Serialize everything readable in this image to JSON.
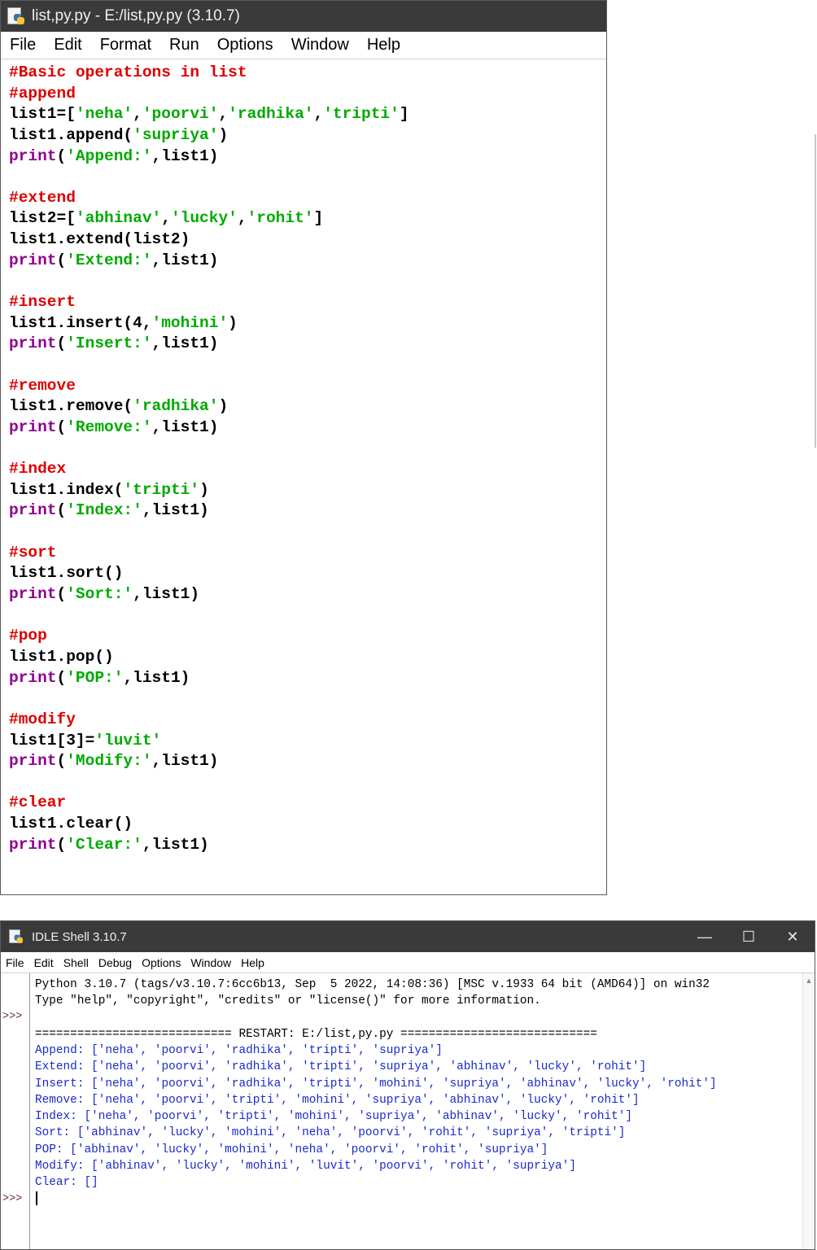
{
  "editor": {
    "title": "list,py.py - E:/list,py.py (3.10.7)",
    "menu": [
      "File",
      "Edit",
      "Format",
      "Run",
      "Options",
      "Window",
      "Help"
    ],
    "code_lines": [
      [
        {
          "t": "#Basic operations in list",
          "c": "comment"
        }
      ],
      [
        {
          "t": "#append",
          "c": "comment"
        }
      ],
      [
        {
          "t": "list1=[",
          "c": "def"
        },
        {
          "t": "'neha'",
          "c": "str"
        },
        {
          "t": ",",
          "c": "def"
        },
        {
          "t": "'poorvi'",
          "c": "str"
        },
        {
          "t": ",",
          "c": "def"
        },
        {
          "t": "'radhika'",
          "c": "str"
        },
        {
          "t": ",",
          "c": "def"
        },
        {
          "t": "'tripti'",
          "c": "str"
        },
        {
          "t": "]",
          "c": "def"
        }
      ],
      [
        {
          "t": "list1.append(",
          "c": "def"
        },
        {
          "t": "'supriya'",
          "c": "str"
        },
        {
          "t": ")",
          "c": "def"
        }
      ],
      [
        {
          "t": "print",
          "c": "kw"
        },
        {
          "t": "(",
          "c": "def"
        },
        {
          "t": "'Append:'",
          "c": "str"
        },
        {
          "t": ",list1)",
          "c": "def"
        }
      ],
      [],
      [
        {
          "t": "#extend",
          "c": "comment"
        }
      ],
      [
        {
          "t": "list2=[",
          "c": "def"
        },
        {
          "t": "'abhinav'",
          "c": "str"
        },
        {
          "t": ",",
          "c": "def"
        },
        {
          "t": "'lucky'",
          "c": "str"
        },
        {
          "t": ",",
          "c": "def"
        },
        {
          "t": "'rohit'",
          "c": "str"
        },
        {
          "t": "]",
          "c": "def"
        }
      ],
      [
        {
          "t": "list1.extend(list2)",
          "c": "def"
        }
      ],
      [
        {
          "t": "print",
          "c": "kw"
        },
        {
          "t": "(",
          "c": "def"
        },
        {
          "t": "'Extend:'",
          "c": "str"
        },
        {
          "t": ",list1)",
          "c": "def"
        }
      ],
      [],
      [
        {
          "t": "#insert",
          "c": "comment"
        }
      ],
      [
        {
          "t": "list1.insert(4,",
          "c": "def"
        },
        {
          "t": "'mohini'",
          "c": "str"
        },
        {
          "t": ")",
          "c": "def"
        }
      ],
      [
        {
          "t": "print",
          "c": "kw"
        },
        {
          "t": "(",
          "c": "def"
        },
        {
          "t": "'Insert:'",
          "c": "str"
        },
        {
          "t": ",list1)",
          "c": "def"
        }
      ],
      [],
      [
        {
          "t": "#remove",
          "c": "comment"
        }
      ],
      [
        {
          "t": "list1.remove(",
          "c": "def"
        },
        {
          "t": "'radhika'",
          "c": "str"
        },
        {
          "t": ")",
          "c": "def"
        }
      ],
      [
        {
          "t": "print",
          "c": "kw"
        },
        {
          "t": "(",
          "c": "def"
        },
        {
          "t": "'Remove:'",
          "c": "str"
        },
        {
          "t": ",list1)",
          "c": "def"
        }
      ],
      [],
      [
        {
          "t": "#index",
          "c": "comment"
        }
      ],
      [
        {
          "t": "list1.index(",
          "c": "def"
        },
        {
          "t": "'tripti'",
          "c": "str"
        },
        {
          "t": ")",
          "c": "def"
        }
      ],
      [
        {
          "t": "print",
          "c": "kw"
        },
        {
          "t": "(",
          "c": "def"
        },
        {
          "t": "'Index:'",
          "c": "str"
        },
        {
          "t": ",list1)",
          "c": "def"
        }
      ],
      [],
      [
        {
          "t": "#sort",
          "c": "comment"
        }
      ],
      [
        {
          "t": "list1.sort()",
          "c": "def"
        }
      ],
      [
        {
          "t": "print",
          "c": "kw"
        },
        {
          "t": "(",
          "c": "def"
        },
        {
          "t": "'Sort:'",
          "c": "str"
        },
        {
          "t": ",list1)",
          "c": "def"
        }
      ],
      [],
      [
        {
          "t": "#pop",
          "c": "comment"
        }
      ],
      [
        {
          "t": "list1.pop()",
          "c": "def"
        }
      ],
      [
        {
          "t": "print",
          "c": "kw"
        },
        {
          "t": "(",
          "c": "def"
        },
        {
          "t": "'POP:'",
          "c": "str"
        },
        {
          "t": ",list1)",
          "c": "def"
        }
      ],
      [],
      [
        {
          "t": "#modify",
          "c": "comment"
        }
      ],
      [
        {
          "t": "list1[3]=",
          "c": "def"
        },
        {
          "t": "'luvit'",
          "c": "str"
        }
      ],
      [
        {
          "t": "print",
          "c": "kw"
        },
        {
          "t": "(",
          "c": "def"
        },
        {
          "t": "'Modify:'",
          "c": "str"
        },
        {
          "t": ",list1)",
          "c": "def"
        }
      ],
      [],
      [
        {
          "t": "#clear",
          "c": "comment"
        }
      ],
      [
        {
          "t": "list1.clear()",
          "c": "def"
        }
      ],
      [
        {
          "t": "print",
          "c": "kw"
        },
        {
          "t": "(",
          "c": "def"
        },
        {
          "t": "'Clear:'",
          "c": "str"
        },
        {
          "t": ",list1)",
          "c": "def"
        }
      ]
    ]
  },
  "shell": {
    "title": "IDLE Shell 3.10.7",
    "window_buttons": [
      "—",
      "☐",
      "✕"
    ],
    "menu": [
      "File",
      "Edit",
      "Shell",
      "Debug",
      "Options",
      "Window",
      "Help"
    ],
    "prompt": ">>>",
    "lines": [
      {
        "t": "Python 3.10.7 (tags/v3.10.7:6cc6b13, Sep  5 2022, 14:08:36) [MSC v.1933 64 bit (AMD64)] on win32",
        "c": "black"
      },
      {
        "t": "Type \"help\", \"copyright\", \"credits\" or \"license()\" for more information.",
        "c": "black"
      },
      {
        "t": "",
        "c": "black"
      },
      {
        "t": "============================ RESTART: E:/list,py.py ============================",
        "c": "black"
      },
      {
        "t": "Append: ['neha', 'poorvi', 'radhika', 'tripti', 'supriya']",
        "c": "blue"
      },
      {
        "t": "Extend: ['neha', 'poorvi', 'radhika', 'tripti', 'supriya', 'abhinav', 'lucky', 'rohit']",
        "c": "blue"
      },
      {
        "t": "Insert: ['neha', 'poorvi', 'radhika', 'tripti', 'mohini', 'supriya', 'abhinav', 'lucky', 'rohit']",
        "c": "blue"
      },
      {
        "t": "Remove: ['neha', 'poorvi', 'tripti', 'mohini', 'supriya', 'abhinav', 'lucky', 'rohit']",
        "c": "blue"
      },
      {
        "t": "Index: ['neha', 'poorvi', 'tripti', 'mohini', 'supriya', 'abhinav', 'lucky', 'rohit']",
        "c": "blue"
      },
      {
        "t": "Sort: ['abhinav', 'lucky', 'mohini', 'neha', 'poorvi', 'rohit', 'supriya', 'tripti']",
        "c": "blue"
      },
      {
        "t": "POP: ['abhinav', 'lucky', 'mohini', 'neha', 'poorvi', 'rohit', 'supriya']",
        "c": "blue"
      },
      {
        "t": "Modify: ['abhinav', 'lucky', 'mohini', 'luvit', 'poorvi', 'rohit', 'supriya']",
        "c": "blue"
      },
      {
        "t": "Clear: []",
        "c": "blue"
      }
    ]
  }
}
